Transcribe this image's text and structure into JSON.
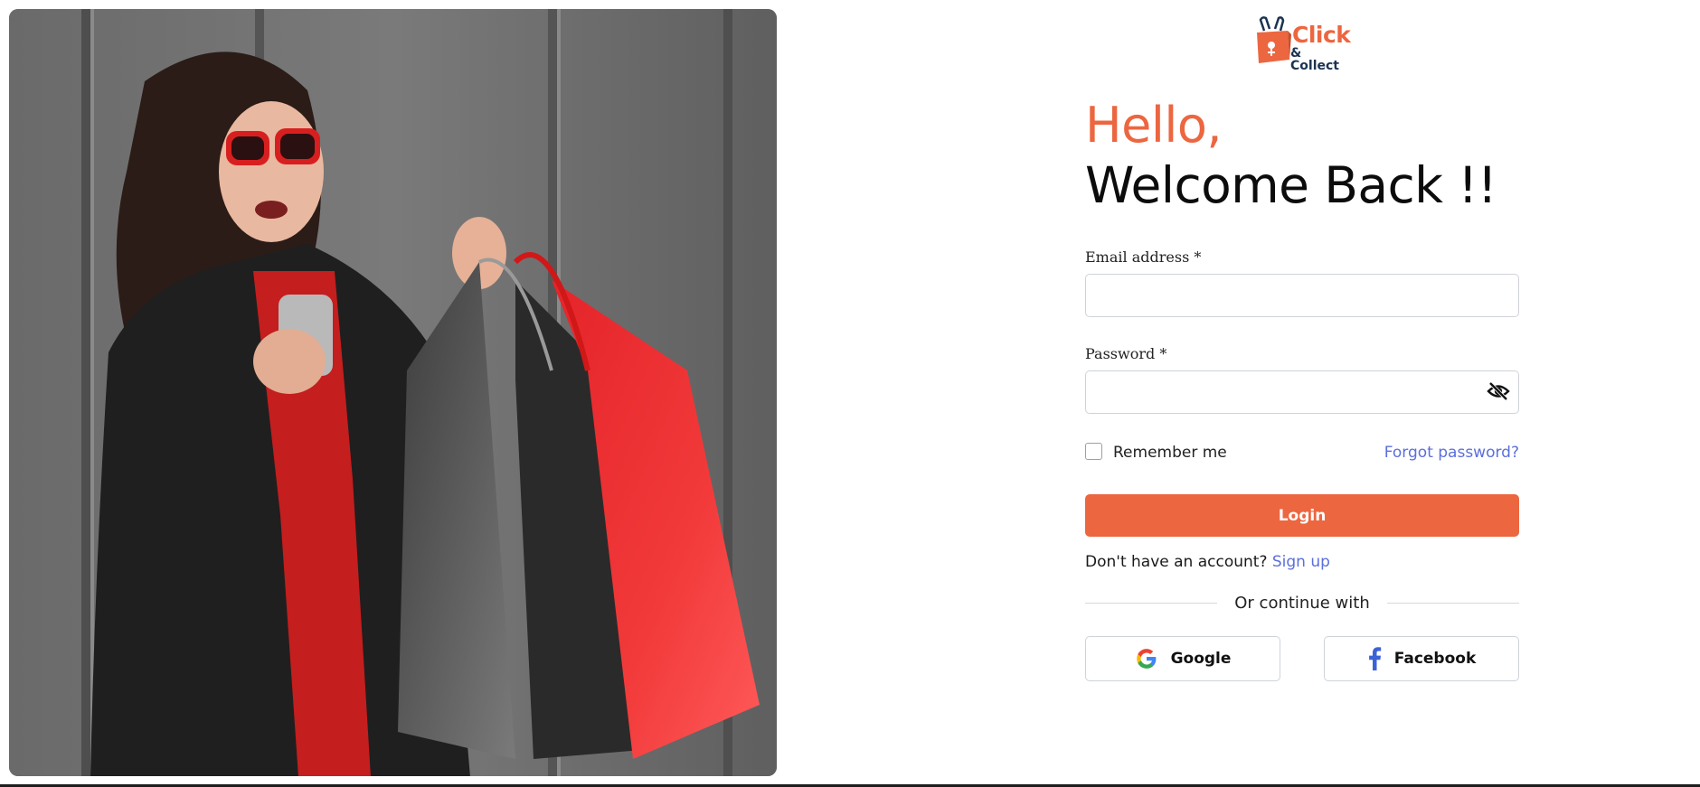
{
  "brand": {
    "line1": "Click",
    "line2": "& Collect"
  },
  "greeting": {
    "line1": "Hello,",
    "line2": "Welcome Back !!"
  },
  "form": {
    "email_label": "Email address *",
    "email_value": "",
    "password_label": "Password *",
    "password_value": "",
    "remember_label": "Remember me",
    "remember_checked": false,
    "forgot_label": "Forgot password?",
    "login_label": "Login"
  },
  "signup": {
    "prompt": "Don't have an account?",
    "link": "Sign up"
  },
  "social": {
    "divider_text": "Or continue with",
    "google_label": "Google",
    "facebook_label": "Facebook"
  },
  "colors": {
    "accent": "#ec6640",
    "link": "#5b6fdc",
    "brand_dark": "#1b3350"
  },
  "icons": [
    "shopping-bag-logo-icon",
    "eye-slash-icon",
    "google-icon",
    "facebook-icon"
  ]
}
